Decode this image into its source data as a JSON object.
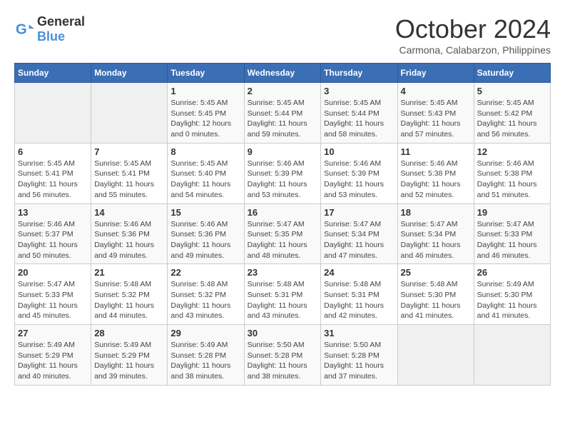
{
  "logo": {
    "general": "General",
    "blue": "Blue"
  },
  "header": {
    "month": "October 2024",
    "location": "Carmona, Calabarzon, Philippines"
  },
  "weekdays": [
    "Sunday",
    "Monday",
    "Tuesday",
    "Wednesday",
    "Thursday",
    "Friday",
    "Saturday"
  ],
  "weeks": [
    [
      {
        "day": "",
        "info": ""
      },
      {
        "day": "",
        "info": ""
      },
      {
        "day": "1",
        "info": "Sunrise: 5:45 AM\nSunset: 5:45 PM\nDaylight: 12 hours\nand 0 minutes."
      },
      {
        "day": "2",
        "info": "Sunrise: 5:45 AM\nSunset: 5:44 PM\nDaylight: 11 hours\nand 59 minutes."
      },
      {
        "day": "3",
        "info": "Sunrise: 5:45 AM\nSunset: 5:44 PM\nDaylight: 11 hours\nand 58 minutes."
      },
      {
        "day": "4",
        "info": "Sunrise: 5:45 AM\nSunset: 5:43 PM\nDaylight: 11 hours\nand 57 minutes."
      },
      {
        "day": "5",
        "info": "Sunrise: 5:45 AM\nSunset: 5:42 PM\nDaylight: 11 hours\nand 56 minutes."
      }
    ],
    [
      {
        "day": "6",
        "info": "Sunrise: 5:45 AM\nSunset: 5:41 PM\nDaylight: 11 hours\nand 56 minutes."
      },
      {
        "day": "7",
        "info": "Sunrise: 5:45 AM\nSunset: 5:41 PM\nDaylight: 11 hours\nand 55 minutes."
      },
      {
        "day": "8",
        "info": "Sunrise: 5:45 AM\nSunset: 5:40 PM\nDaylight: 11 hours\nand 54 minutes."
      },
      {
        "day": "9",
        "info": "Sunrise: 5:46 AM\nSunset: 5:39 PM\nDaylight: 11 hours\nand 53 minutes."
      },
      {
        "day": "10",
        "info": "Sunrise: 5:46 AM\nSunset: 5:39 PM\nDaylight: 11 hours\nand 53 minutes."
      },
      {
        "day": "11",
        "info": "Sunrise: 5:46 AM\nSunset: 5:38 PM\nDaylight: 11 hours\nand 52 minutes."
      },
      {
        "day": "12",
        "info": "Sunrise: 5:46 AM\nSunset: 5:38 PM\nDaylight: 11 hours\nand 51 minutes."
      }
    ],
    [
      {
        "day": "13",
        "info": "Sunrise: 5:46 AM\nSunset: 5:37 PM\nDaylight: 11 hours\nand 50 minutes."
      },
      {
        "day": "14",
        "info": "Sunrise: 5:46 AM\nSunset: 5:36 PM\nDaylight: 11 hours\nand 49 minutes."
      },
      {
        "day": "15",
        "info": "Sunrise: 5:46 AM\nSunset: 5:36 PM\nDaylight: 11 hours\nand 49 minutes."
      },
      {
        "day": "16",
        "info": "Sunrise: 5:47 AM\nSunset: 5:35 PM\nDaylight: 11 hours\nand 48 minutes."
      },
      {
        "day": "17",
        "info": "Sunrise: 5:47 AM\nSunset: 5:34 PM\nDaylight: 11 hours\nand 47 minutes."
      },
      {
        "day": "18",
        "info": "Sunrise: 5:47 AM\nSunset: 5:34 PM\nDaylight: 11 hours\nand 46 minutes."
      },
      {
        "day": "19",
        "info": "Sunrise: 5:47 AM\nSunset: 5:33 PM\nDaylight: 11 hours\nand 46 minutes."
      }
    ],
    [
      {
        "day": "20",
        "info": "Sunrise: 5:47 AM\nSunset: 5:33 PM\nDaylight: 11 hours\nand 45 minutes."
      },
      {
        "day": "21",
        "info": "Sunrise: 5:48 AM\nSunset: 5:32 PM\nDaylight: 11 hours\nand 44 minutes."
      },
      {
        "day": "22",
        "info": "Sunrise: 5:48 AM\nSunset: 5:32 PM\nDaylight: 11 hours\nand 43 minutes."
      },
      {
        "day": "23",
        "info": "Sunrise: 5:48 AM\nSunset: 5:31 PM\nDaylight: 11 hours\nand 43 minutes."
      },
      {
        "day": "24",
        "info": "Sunrise: 5:48 AM\nSunset: 5:31 PM\nDaylight: 11 hours\nand 42 minutes."
      },
      {
        "day": "25",
        "info": "Sunrise: 5:48 AM\nSunset: 5:30 PM\nDaylight: 11 hours\nand 41 minutes."
      },
      {
        "day": "26",
        "info": "Sunrise: 5:49 AM\nSunset: 5:30 PM\nDaylight: 11 hours\nand 41 minutes."
      }
    ],
    [
      {
        "day": "27",
        "info": "Sunrise: 5:49 AM\nSunset: 5:29 PM\nDaylight: 11 hours\nand 40 minutes."
      },
      {
        "day": "28",
        "info": "Sunrise: 5:49 AM\nSunset: 5:29 PM\nDaylight: 11 hours\nand 39 minutes."
      },
      {
        "day": "29",
        "info": "Sunrise: 5:49 AM\nSunset: 5:28 PM\nDaylight: 11 hours\nand 38 minutes."
      },
      {
        "day": "30",
        "info": "Sunrise: 5:50 AM\nSunset: 5:28 PM\nDaylight: 11 hours\nand 38 minutes."
      },
      {
        "day": "31",
        "info": "Sunrise: 5:50 AM\nSunset: 5:28 PM\nDaylight: 11 hours\nand 37 minutes."
      },
      {
        "day": "",
        "info": ""
      },
      {
        "day": "",
        "info": ""
      }
    ]
  ]
}
